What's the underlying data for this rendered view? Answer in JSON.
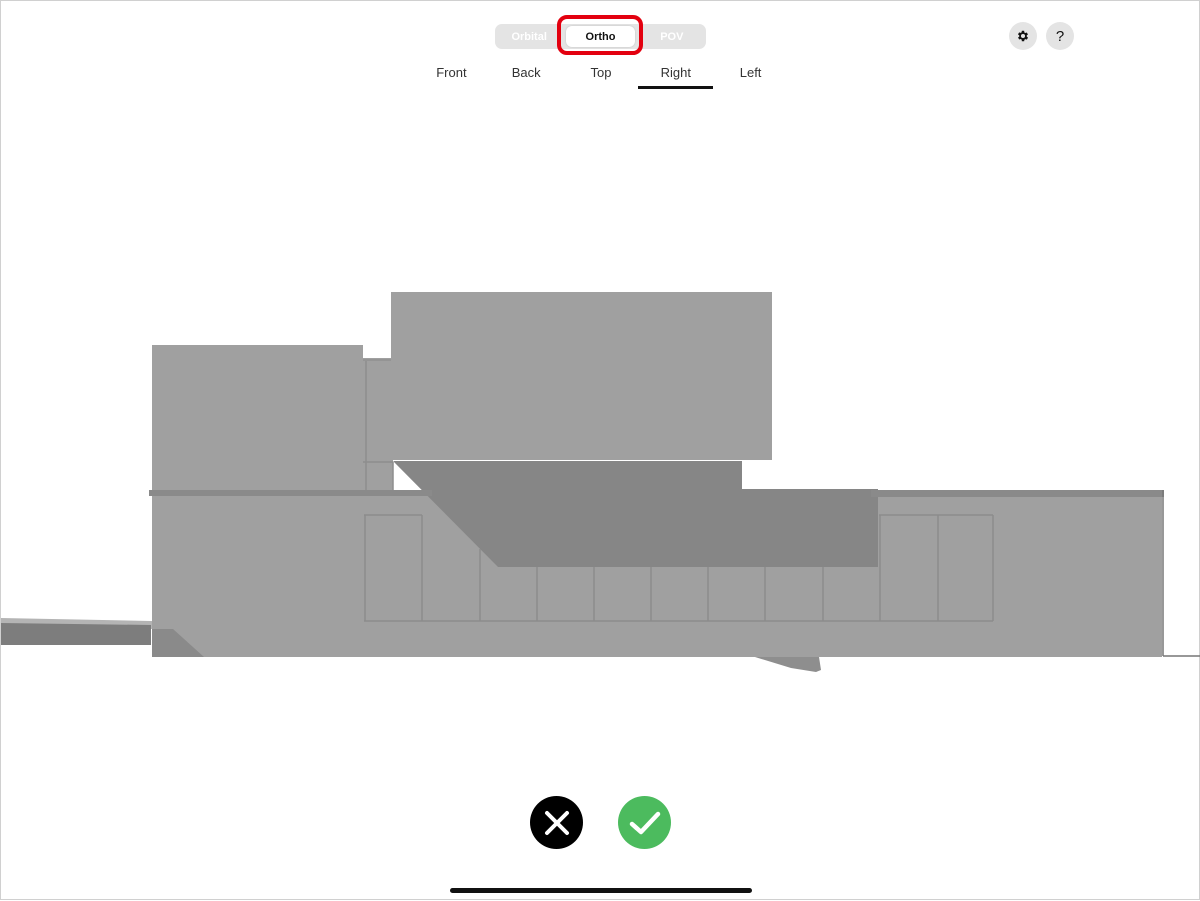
{
  "header": {
    "mode_switch": {
      "options": [
        "Orbital",
        "Ortho",
        "POV"
      ],
      "selected": "Ortho"
    },
    "view_tabs": {
      "options": [
        "Front",
        "Back",
        "Top",
        "Right",
        "Left"
      ],
      "selected": "Right"
    },
    "settings_icon": "gear-icon",
    "help_label": "?"
  },
  "viewport": {
    "content": "Building elevation model (right orthographic view)",
    "colors": {
      "wall": "#a0a0a0",
      "shadow": "#868686",
      "ground_dark": "#7a7a7a",
      "line": "#8c8c8c"
    }
  },
  "footer": {
    "cancel_icon": "close-icon",
    "confirm_icon": "check-icon",
    "cancel_color": "#000000",
    "confirm_color": "#4cbb5e"
  },
  "accent": {
    "highlight_ring": "#e3000f"
  }
}
